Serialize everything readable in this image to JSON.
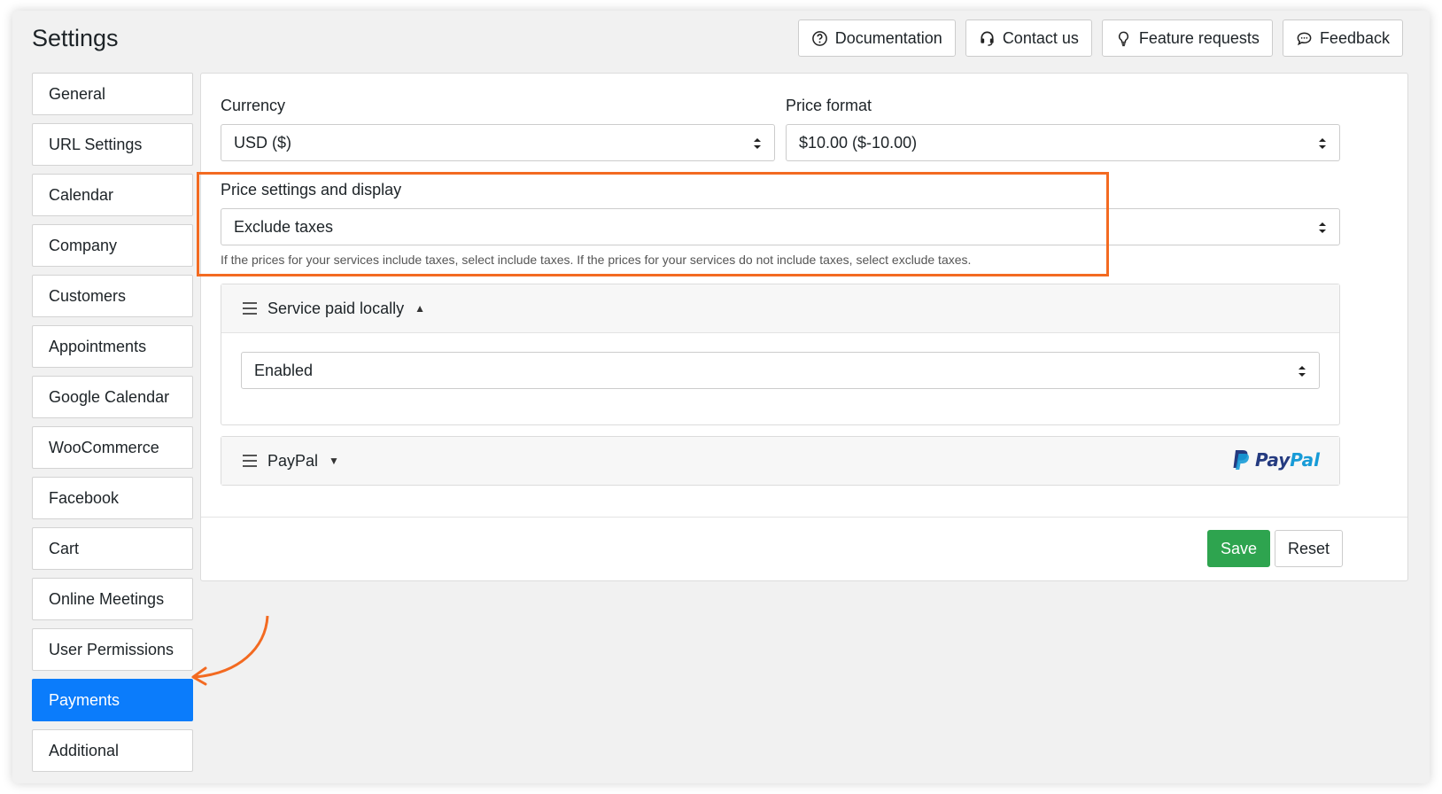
{
  "page": {
    "title": "Settings"
  },
  "top_actions": [
    {
      "label": "Documentation",
      "icon": "help-circle-icon"
    },
    {
      "label": "Contact us",
      "icon": "headset-icon"
    },
    {
      "label": "Feature requests",
      "icon": "lightbulb-icon"
    },
    {
      "label": "Feedback",
      "icon": "chat-bubble-icon"
    }
  ],
  "sidebar": {
    "items": [
      {
        "label": "General"
      },
      {
        "label": "URL Settings"
      },
      {
        "label": "Calendar"
      },
      {
        "label": "Company"
      },
      {
        "label": "Customers"
      },
      {
        "label": "Appointments"
      },
      {
        "label": "Google Calendar"
      },
      {
        "label": "WooCommerce"
      },
      {
        "label": "Facebook"
      },
      {
        "label": "Cart"
      },
      {
        "label": "Online Meetings"
      },
      {
        "label": "User Permissions"
      },
      {
        "label": "Payments",
        "active": true
      },
      {
        "label": "Additional"
      }
    ]
  },
  "main": {
    "currency": {
      "label": "Currency",
      "value": "USD ($)"
    },
    "price_format": {
      "label": "Price format",
      "value": "$10.00 ($-10.00)"
    },
    "price_settings": {
      "label": "Price settings and display",
      "value": "Exclude taxes",
      "help": "If the prices for your services include taxes, select include taxes. If the prices for your services do not include taxes, select exclude taxes."
    },
    "service_paid_locally": {
      "title": "Service paid locally",
      "value": "Enabled"
    },
    "paypal": {
      "title": "PayPal",
      "logo_text": "PayPal"
    },
    "buttons": {
      "save": "Save",
      "reset": "Reset"
    }
  },
  "colors": {
    "accent": "#0b7cfb",
    "highlight": "#f36a21",
    "save": "#2ea44f",
    "paypal_dark": "#253b80",
    "paypal_light": "#179bd7"
  }
}
